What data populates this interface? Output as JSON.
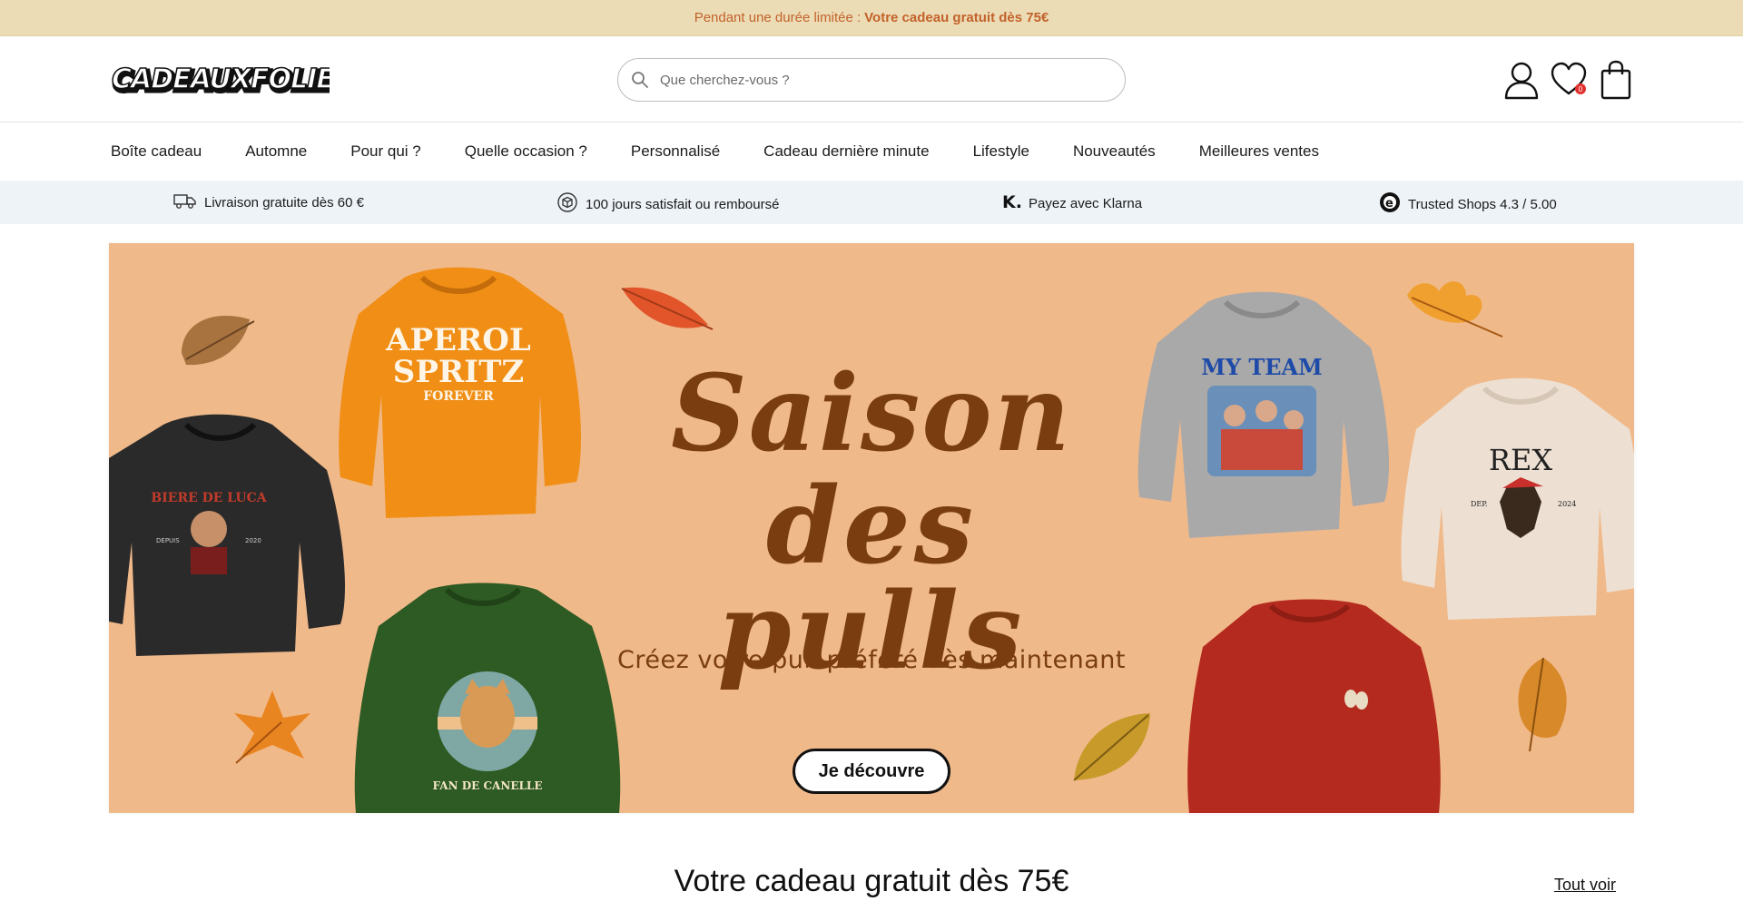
{
  "announcement": {
    "prefix": "Pendant une durée limitée :",
    "highlight": "Votre cadeau gratuit dès 75€"
  },
  "header": {
    "logo_text": "CADEAUXFOLIES",
    "search_placeholder": "Que cherchez-vous ?",
    "wishlist_count": "0",
    "icons": [
      "search-icon",
      "account-icon",
      "heart-icon",
      "bag-icon"
    ]
  },
  "nav": {
    "items": [
      {
        "label": "Boîte cadeau"
      },
      {
        "label": "Automne"
      },
      {
        "label": "Pour qui ?"
      },
      {
        "label": "Quelle occasion ?"
      },
      {
        "label": "Personnalisé"
      },
      {
        "label": "Cadeau dernière minute"
      },
      {
        "label": "Lifestyle"
      },
      {
        "label": "Nouveautés"
      },
      {
        "label": "Meilleures ventes"
      }
    ]
  },
  "trust": {
    "items": [
      {
        "label": "Livraison gratuite dès 60 €",
        "icon": "truck-icon"
      },
      {
        "label": "100 jours satisfait ou remboursé",
        "icon": "box-return-icon"
      },
      {
        "label": "Payez avec Klarna",
        "icon": "klarna-icon"
      },
      {
        "label": "Trusted Shops 4.3 / 5.00",
        "icon": "trusted-shops-icon"
      }
    ]
  },
  "hero": {
    "title_line1": "Saison",
    "title_line2": "des pulls",
    "subtitle": "Créez votre pull préféré dès maintenant",
    "cta": "Je découvre",
    "sweater_texts": {
      "orange_line1": "APEROL",
      "orange_line2": "SPRITZ",
      "orange_line3": "FOREVER",
      "black_text": "BIERE DE LUCA",
      "black_left": "DEPUIS",
      "black_right": "2020",
      "green_text": "FAN DE CANELLE",
      "grey_text": "MY TEAM",
      "cream_text": "REX",
      "cream_left": "DEP.",
      "cream_right": "2024"
    },
    "colors": {
      "background": "#f0b98a",
      "title": "#7a3d10"
    }
  },
  "section": {
    "title": "Votre cadeau gratuit dès 75€",
    "see_all": "Tout voir"
  }
}
